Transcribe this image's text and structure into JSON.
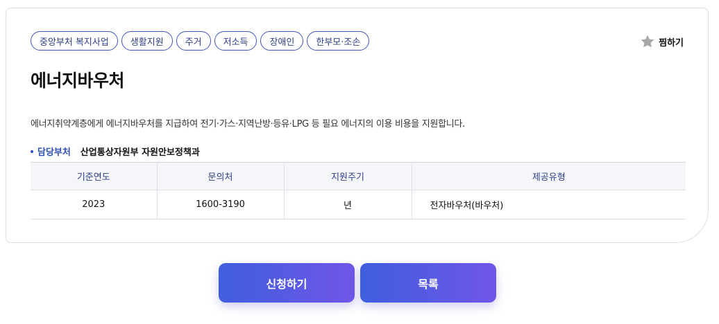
{
  "tags": [
    "중앙부처 복지사업",
    "생활지원",
    "주거",
    "저소득",
    "장애인",
    "한부모·조손"
  ],
  "favorite": {
    "label": "찜하기",
    "icon": "star-icon"
  },
  "title": "에너지바우처",
  "description": "에너지취약계층에게 에너지바우처를 지급하여 전기·가스·지역난방·등유·LPG 등 필요 에너지의 이용 비용을 지원합니다.",
  "department": {
    "label": "담당부처",
    "value": "산업통상자원부 자원안보정책과"
  },
  "table": {
    "headers": [
      "기준연도",
      "문의처",
      "지원주기",
      "제공유형"
    ],
    "row": [
      "2023",
      "1600-3190",
      "년",
      "전자바우처(바우처)"
    ]
  },
  "buttons": {
    "apply": "신청하기",
    "list": "목록"
  },
  "colors": {
    "accent": "#2e4fb8",
    "button_start": "#3f5edd",
    "button_end": "#7056e6",
    "star": "#a8a8a8"
  }
}
